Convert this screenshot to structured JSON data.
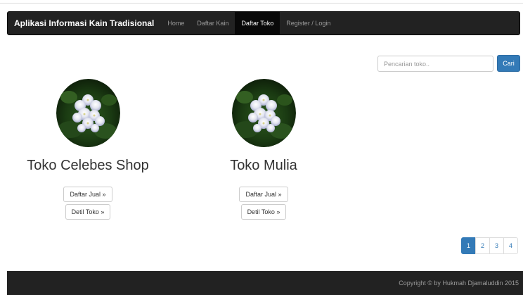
{
  "navbar": {
    "brand": "Aplikasi Informasi Kain Tradisional",
    "items": [
      {
        "label": "Home",
        "active": false
      },
      {
        "label": "Daftar Kain",
        "active": false
      },
      {
        "label": "Daftar Toko",
        "active": true
      },
      {
        "label": "Register / Login",
        "active": false
      }
    ]
  },
  "search": {
    "placeholder": "Pencarian toko..",
    "value": "",
    "button_label": "Cari"
  },
  "stores": [
    {
      "name": "Toko Celebes Shop",
      "list_button": "Daftar Jual »",
      "detail_button": "Detil Toko »"
    },
    {
      "name": "Toko Mulia",
      "list_button": "Daftar Jual »",
      "detail_button": "Detil Toko »"
    }
  ],
  "pagination": {
    "pages": [
      "1",
      "2",
      "3",
      "4"
    ],
    "active": "1"
  },
  "footer": {
    "text": "Copyright © by Hukmah Djamaluddin 2015"
  },
  "colors": {
    "navbar_bg": "#222222",
    "active_nav_bg": "#080808",
    "primary": "#337ab7",
    "footer_bg": "#222222"
  },
  "icons": {
    "store_image": "hydrangea-flower-photo"
  }
}
